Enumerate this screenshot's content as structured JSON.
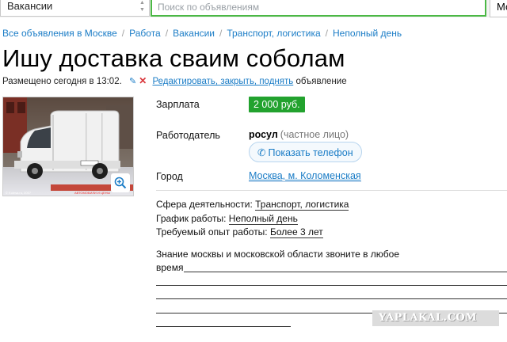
{
  "topbar": {
    "category": "Вакансии",
    "search_placeholder": "Поиск по объявлениям",
    "region": "Мо"
  },
  "breadcrumb": [
    "Все объявления в Москве",
    "Работа",
    "Вакансии",
    "Транспорт, логистика",
    "Неполный день"
  ],
  "title": "Ишу доставка сваим соболам",
  "meta": {
    "posted": "Размещено сегодня в 13:02.",
    "edit_link": "Редактировать, закрыть, поднять",
    "edit_suffix": "объявление"
  },
  "photo": {
    "caption_left": "© Kolesa.ru, 2007",
    "caption_right": "АВТОМОБИЛИ И ЦЕНЫ"
  },
  "details": {
    "salary_label": "Зарплата",
    "salary_value": "2 000 руб.",
    "employer_label": "Работодатель",
    "employer_name": "росул",
    "employer_type": "(частное лицо)",
    "phone_button": "Показать телефон",
    "city_label": "Город",
    "city_value": "Москва, м. Коломенская"
  },
  "params": [
    {
      "label": "Сфера деятельности:",
      "value": "Транспорт, логистика"
    },
    {
      "label": "График работы:",
      "value": "Неполный день"
    },
    {
      "label": "Требуемый опыт работы:",
      "value": "Более 3 лет"
    }
  ],
  "description": {
    "line1": "Знание москвы и московской области звоните в любое",
    "line2": "время"
  },
  "watermark": "YAPLAKAL.COM",
  "colors": {
    "accent_green": "#4bb845",
    "price_green": "#22a22e",
    "link_blue": "#1a7cc6",
    "delete_red": "#d9353a"
  },
  "icons": [
    "chevron-updown-icon",
    "pencil-icon",
    "close-icon",
    "zoom-in-icon",
    "phone-icon"
  ]
}
